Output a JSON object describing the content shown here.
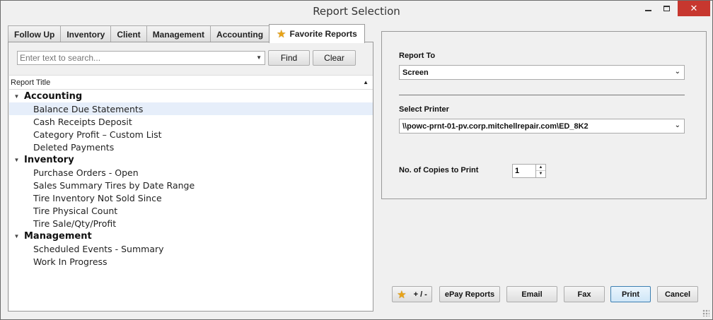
{
  "window": {
    "title": "Report Selection",
    "close_glyph": "✕"
  },
  "tabs": [
    {
      "label": "Follow Up",
      "active": false
    },
    {
      "label": "Inventory",
      "active": false
    },
    {
      "label": "Client",
      "active": false
    },
    {
      "label": "Management",
      "active": false
    },
    {
      "label": "Accounting",
      "active": false
    },
    {
      "label": "Favorite Reports",
      "active": true,
      "icon": "star-icon"
    }
  ],
  "search": {
    "placeholder": "Enter text to search...",
    "value": "",
    "find_label": "Find",
    "clear_label": "Clear"
  },
  "list": {
    "header": "Report Title",
    "groups": [
      {
        "name": "Accounting",
        "items": [
          "Balance Due Statements",
          "Cash Receipts Deposit",
          "Category Profit – Custom List",
          "Deleted Payments"
        ]
      },
      {
        "name": "Inventory",
        "items": [
          "Purchase Orders - Open",
          "Sales Summary Tires by Date Range",
          "Tire Inventory Not Sold Since",
          "Tire Physical Count",
          "Tire Sale/Qty/Profit"
        ]
      },
      {
        "name": "Management",
        "items": [
          "Scheduled Events - Summary",
          "Work In Progress"
        ]
      }
    ],
    "selected": "Balance Due Statements"
  },
  "settings": {
    "report_to_label": "Report To",
    "report_to_value": "Screen",
    "printer_label": "Select Printer",
    "printer_value": "\\\\powc-prnt-01-pv.corp.mitchellrepair.com\\ED_8K2",
    "copies_label": "No. of Copies to Print",
    "copies_value": "1"
  },
  "buttons": {
    "favorites_label": "+ / -",
    "epay_label": "ePay Reports",
    "email_label": "Email",
    "fax_label": "Fax",
    "print_label": "Print",
    "cancel_label": "Cancel"
  },
  "colors": {
    "selected_row": "#e6eefa",
    "close_button": "#c7372f",
    "star": "#e8a317"
  }
}
